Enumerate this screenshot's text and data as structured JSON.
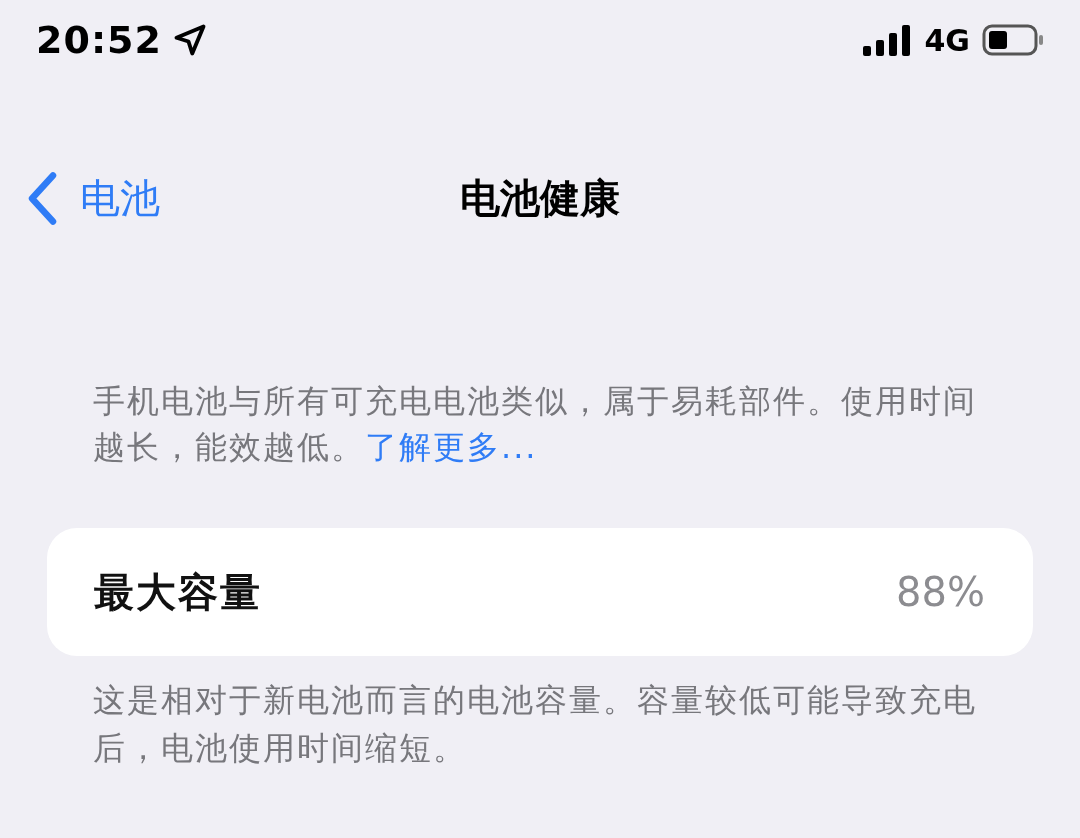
{
  "status_bar": {
    "time": "20:52",
    "network": "4G"
  },
  "nav": {
    "back_label": "电池",
    "title": "电池健康"
  },
  "intro": {
    "text": "手机电池与所有可充电电池类似，属于易耗部件。使用时间越长，能效越低。",
    "link": "了解更多..."
  },
  "capacity": {
    "label": "最大容量",
    "value": "88%"
  },
  "footer": "这是相对于新电池而言的电池容量。容量较低可能导致充电后，电池使用时间缩短。"
}
